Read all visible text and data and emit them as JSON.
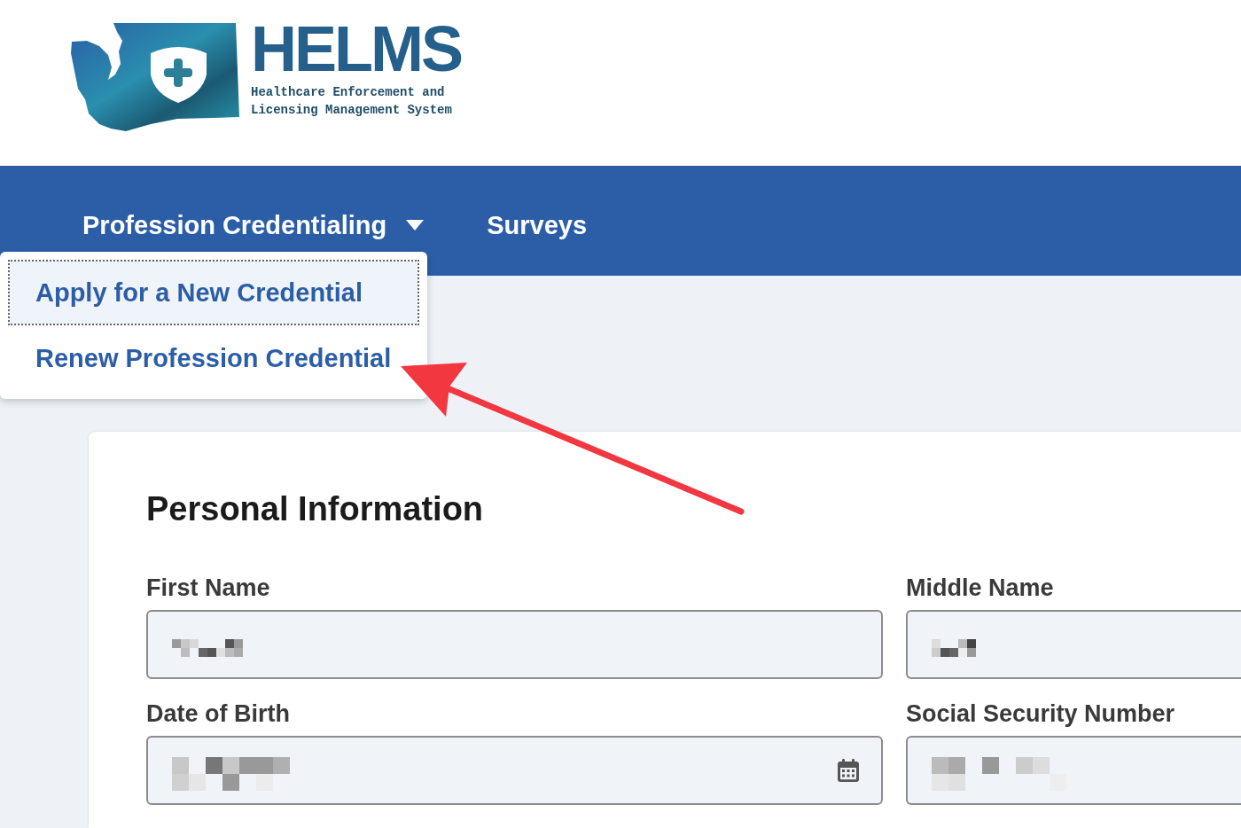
{
  "logo": {
    "title": "HELMS",
    "subtitle": "Healthcare Enforcement and Licensing Management System"
  },
  "nav": {
    "items": [
      {
        "label": "Profession Credentialing",
        "kind": "dropdown",
        "expanded": true,
        "menu": [
          {
            "label": "Apply for a New Credential",
            "focused": true
          },
          {
            "label": "Renew Profession Credential",
            "focused": false
          }
        ]
      },
      {
        "label": "Surveys",
        "kind": "link"
      }
    ]
  },
  "form": {
    "title": "Personal Information",
    "fields": [
      {
        "label": "First Name",
        "kind": "text",
        "redacted": true
      },
      {
        "label": "Middle Name",
        "kind": "text",
        "redacted": true
      },
      {
        "label": "Date of Birth",
        "kind": "date",
        "redacted": true
      },
      {
        "label": "Social Security Number",
        "kind": "text",
        "redacted": true
      }
    ]
  }
}
